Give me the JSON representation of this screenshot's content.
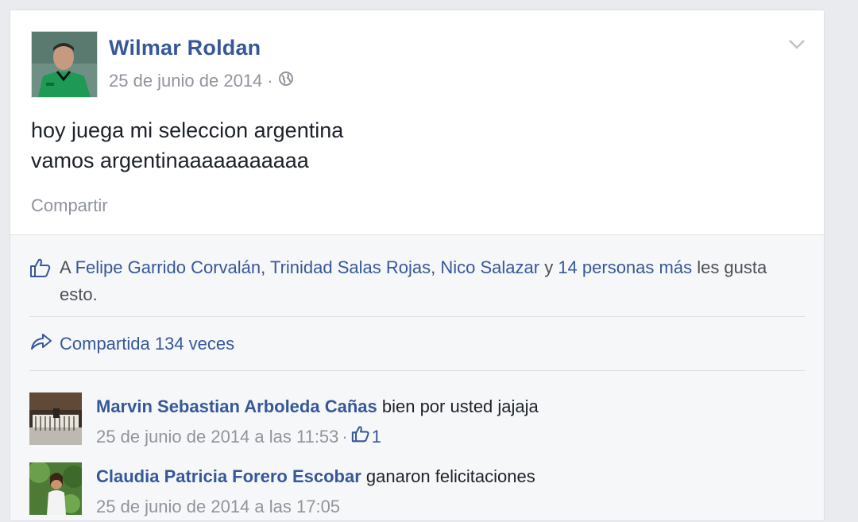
{
  "post": {
    "author": "Wilmar Roldan",
    "date": "25 de junio de 2014",
    "separator": "·",
    "privacy_icon": "globe-icon",
    "text_line1": "hoy juega mi seleccion argentina",
    "text_line2": "vamos argentinaaaaaaaaaaa",
    "share_label": "Compartir",
    "menu_icon": "chevron-down-icon"
  },
  "likes": {
    "prefix": "A ",
    "name1": "Felipe Garrido Corvalán",
    "sep1": ", ",
    "name2": "Trinidad Salas Rojas",
    "sep2": ", ",
    "name3": "Nico Salazar",
    "conj": " y ",
    "others": "14 personas más",
    "suffix": " les gusta esto.",
    "icon": "thumbs-up-icon"
  },
  "shares": {
    "label": "Compartida 134 veces",
    "icon": "share-arrow-icon"
  },
  "comments": [
    {
      "author": "Marvin Sebastian Arboleda Cañas",
      "text": " bien por usted jajaja",
      "timestamp": "25 de junio de 2014 a las 11:53",
      "separator": "·",
      "like_count": "1"
    },
    {
      "author": "Claudia Patricia Forero Escobar",
      "text": " ganaron felicitaciones",
      "timestamp": "25 de junio de 2014 a las 17:05"
    }
  ],
  "colors": {
    "link": "#365899",
    "meta": "#90949c",
    "text": "#1d2129",
    "footer_bg": "#f6f7f9"
  }
}
